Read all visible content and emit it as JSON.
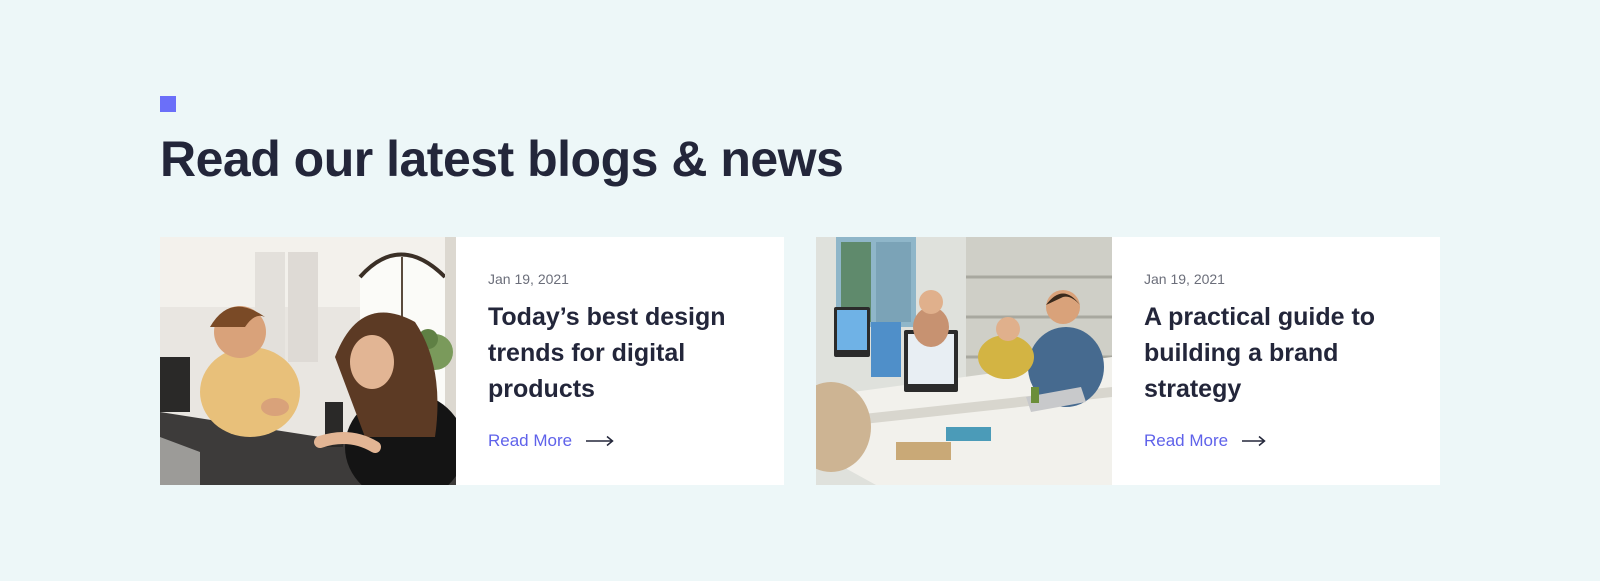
{
  "section": {
    "heading": "Read our latest blogs & news"
  },
  "colors": {
    "background": "#edf7f8",
    "accent": "#6b6ff9",
    "link": "#5f62ea",
    "text": "#23263a"
  },
  "posts": [
    {
      "date": "Jan 19, 2021",
      "title": "Today’s best design trends for digital products",
      "link_label": "Read More",
      "image_icon": "photo-two-women-laughing-at-laptop",
      "arrow_icon": "arrow-right-icon"
    },
    {
      "date": "Jan 19, 2021",
      "title": "A practical guide to building a brand strategy",
      "link_label": "Read More",
      "image_icon": "photo-team-working-in-office",
      "arrow_icon": "arrow-right-icon"
    }
  ]
}
